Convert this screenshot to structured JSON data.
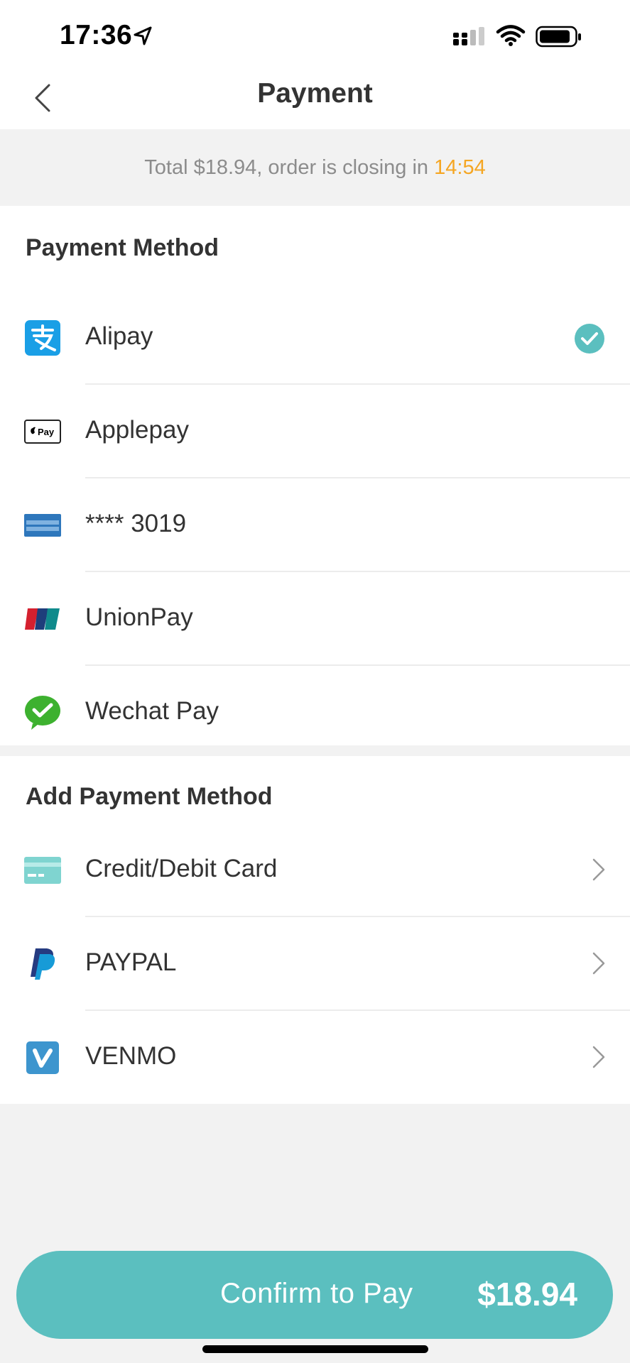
{
  "status_bar": {
    "time": "17:36",
    "icons": [
      "location-arrow-icon",
      "cellular-signal-icon",
      "wifi-icon",
      "battery-icon"
    ]
  },
  "nav": {
    "title": "Payment",
    "back_icon": "chevron-left-icon"
  },
  "summary": {
    "prefix": "Total $18.94, order is closing in ",
    "countdown": "14:54"
  },
  "payment_methods": {
    "title": "Payment Method",
    "items": [
      {
        "label": "Alipay",
        "icon": "alipay-icon",
        "selected": true
      },
      {
        "label": "Applepay",
        "icon": "applepay-icon",
        "selected": false
      },
      {
        "label": "**** 3019",
        "icon": "amex-card-icon",
        "selected": false
      },
      {
        "label": "UnionPay",
        "icon": "unionpay-icon",
        "selected": false
      },
      {
        "label": "Wechat Pay",
        "icon": "wechat-pay-icon",
        "selected": false
      }
    ]
  },
  "add_payment": {
    "title": "Add Payment Method",
    "items": [
      {
        "label": "Credit/Debit Card",
        "icon": "credit-card-icon"
      },
      {
        "label": "PAYPAL",
        "icon": "paypal-icon"
      },
      {
        "label": "VENMO",
        "icon": "venmo-icon"
      }
    ]
  },
  "confirm": {
    "label": "Confirm to Pay",
    "amount": "$18.94"
  },
  "colors": {
    "accent": "#5bbfbf",
    "countdown": "#f5a623",
    "background": "#f2f2f2"
  }
}
